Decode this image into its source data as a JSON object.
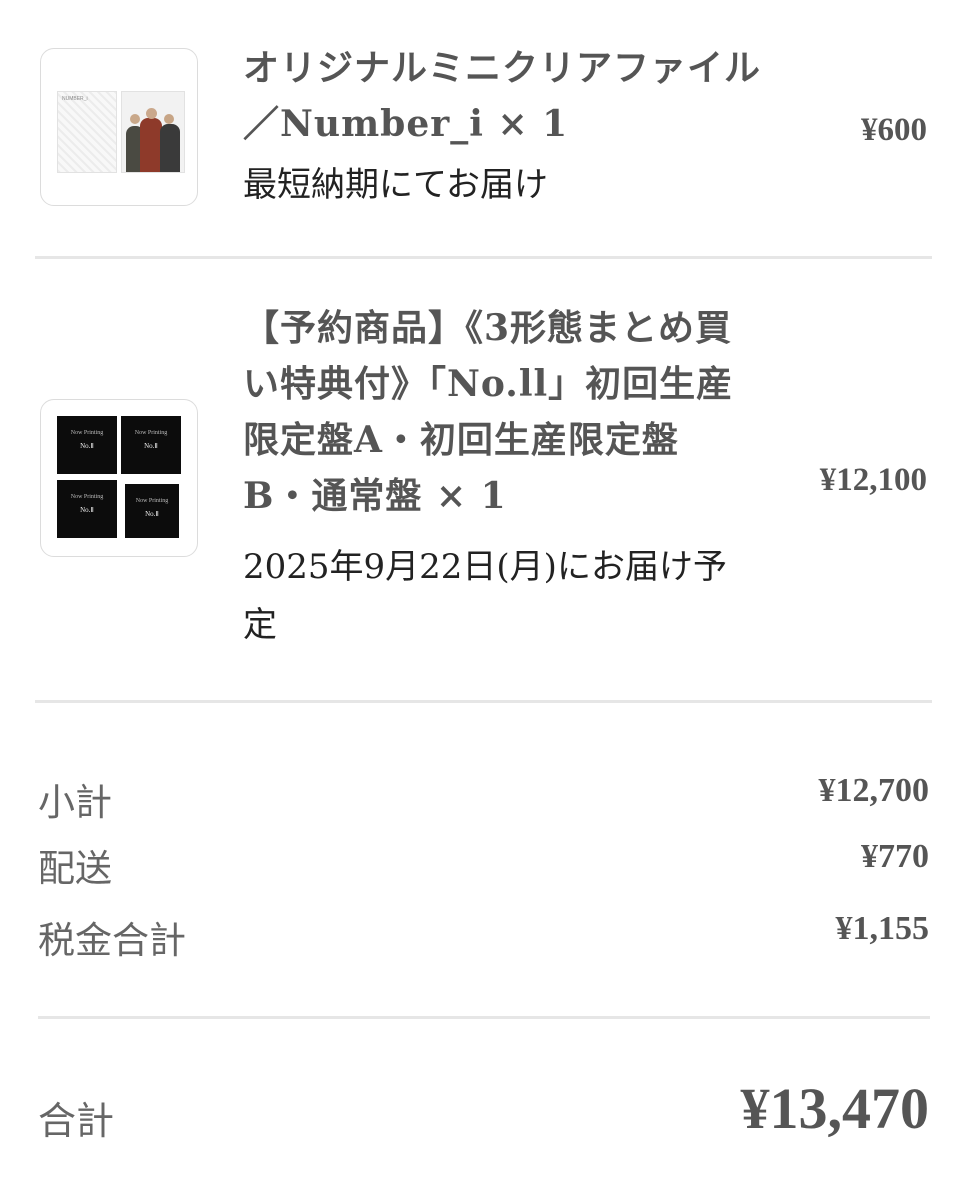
{
  "items": [
    {
      "title": "オリジナルミニクリアファイル／Number_i",
      "quantity": "× 1",
      "note": "最短納期にてお届け",
      "price": "¥600",
      "thumbnail_text": "NUMBER_i"
    },
    {
      "title": "【予約商品】《3形態まとめ買い特典付》「No.ll」初回生産限定盤A・初回生産限定盤B・通常盤",
      "quantity": "× 1",
      "note": "2025年9月22日(月)にお届け予定",
      "price": "¥12,100",
      "covers": [
        {
          "label": "Now Printing",
          "no": "No.Ⅱ"
        },
        {
          "label": "Now Printing",
          "no": "No.Ⅱ"
        },
        {
          "label": "Now Printing",
          "no": "No.Ⅱ"
        },
        {
          "label": "Now Printing",
          "no": "No.Ⅱ"
        }
      ]
    }
  ],
  "summary": {
    "subtotal_label": "小計",
    "subtotal_value": "¥12,700",
    "shipping_label": "配送",
    "shipping_value": "¥770",
    "tax_label": "税金合計",
    "tax_value": "¥1,155"
  },
  "total": {
    "label": "合計",
    "value": "¥13,470"
  }
}
